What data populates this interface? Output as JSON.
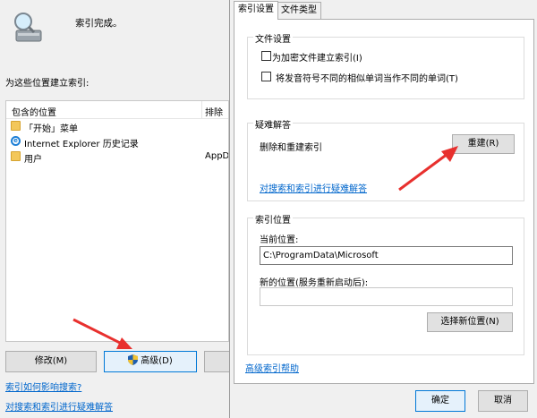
{
  "left_window": {
    "status": "索引完成。",
    "locations_label": "为这些位置建立索引:",
    "list": {
      "col_included": "包含的位置",
      "col_exclude": "排除",
      "rows": [
        {
          "name": "「开始」菜单",
          "icon": "folder-icon",
          "exclude": ""
        },
        {
          "name": "Internet Explorer 历史记录",
          "icon": "internet-explorer-icon",
          "exclude": ""
        },
        {
          "name": "用户",
          "icon": "folder-icon",
          "exclude": "AppD"
        }
      ]
    },
    "buttons": {
      "modify": "修改(M)",
      "advanced": "高级(D)"
    },
    "links": {
      "how_index": "索引如何影响搜索?",
      "troubleshoot": "对搜索和索引进行疑难解答"
    }
  },
  "dialog": {
    "tabs": [
      "索引设置",
      "文件类型"
    ],
    "file_settings": {
      "title": "文件设置",
      "encrypt_label": "为加密文件建立索引(I)",
      "diacritics_label": "将发音符号不同的相似单词当作不同的单词(T)"
    },
    "troubleshooting": {
      "title": "疑难解答",
      "rebuild_text": "删除和重建索引",
      "rebuild_button": "重建(R)",
      "troubleshoot_link": "对搜索和索引进行疑难解答"
    },
    "index_location": {
      "title": "索引位置",
      "current_label": "当前位置:",
      "current_value": "C:\\ProgramData\\Microsoft",
      "new_label": "新的位置(服务重新启动后):",
      "new_value": "",
      "select_button": "选择新位置(N)"
    },
    "help_link": "高级索引帮助",
    "ok": "确定",
    "cancel": "取消"
  },
  "colors": {
    "arrow": "#e8302e",
    "link": "#0066cc",
    "focus": "#0078d7"
  }
}
